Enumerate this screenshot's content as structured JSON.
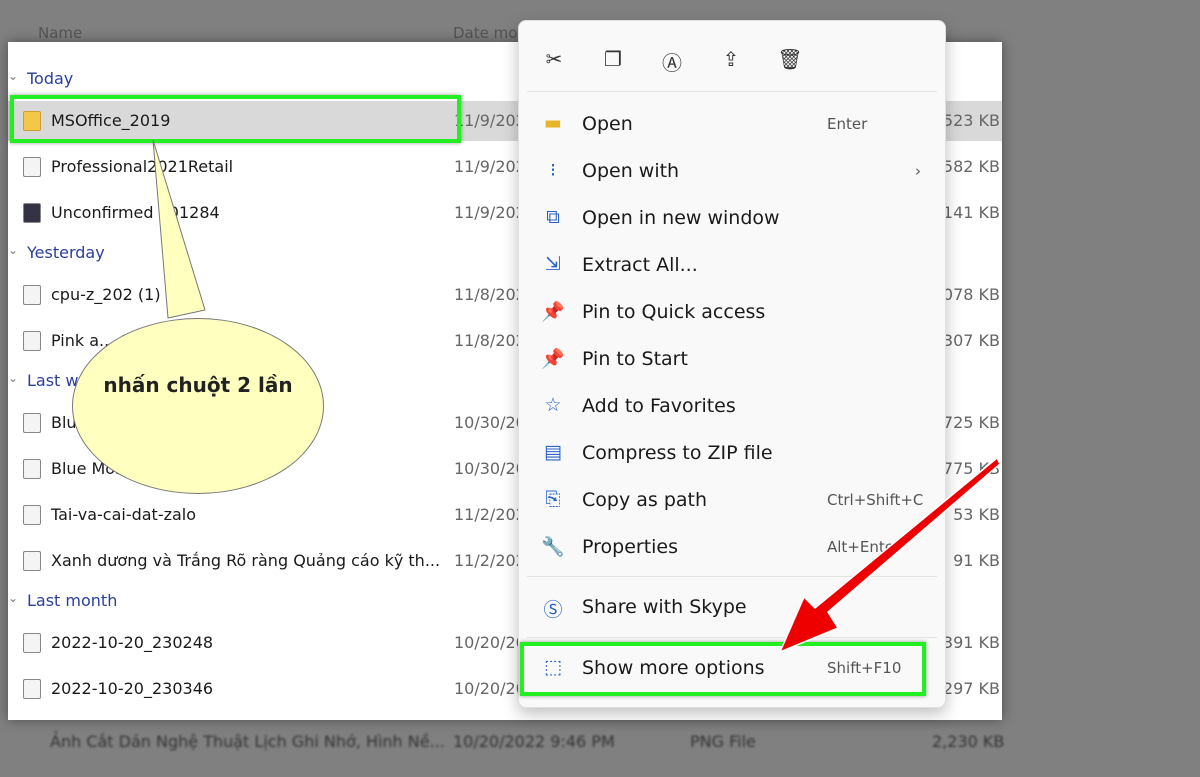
{
  "header": {
    "name_col": "Name",
    "date_col": "Date mo"
  },
  "groups": [
    {
      "label": "Today",
      "files": [
        {
          "name": "MSOffice_2019",
          "date": "11/9/202",
          "size": "523 KB",
          "icon": "zip-folder-icon",
          "selected": true
        },
        {
          "name": "Professional2021Retail",
          "date": "11/9/202",
          "size": "582 KB",
          "icon": "disc-image-icon"
        },
        {
          "name": "Unconfirmed 701284",
          "date": "11/9/202",
          "size": "141 KB",
          "icon": "image-app-icon"
        }
      ]
    },
    {
      "label": "Yesterday",
      "files": [
        {
          "name": "cpu-z_202 (1)",
          "date": "11/8/202",
          "size": "078 KB",
          "icon": "installer-icon"
        },
        {
          "name": "Pink a... Channel Yout...",
          "date": "11/8/202",
          "size": "307 KB",
          "icon": "image-file-icon"
        }
      ]
    },
    {
      "label": "Last w",
      "files": [
        {
          "name": "Blue ... Channel Art",
          "date": "10/30/20",
          "size": "725 KB",
          "icon": "image-file-icon"
        },
        {
          "name": "Blue Mo... Channel Art",
          "date": "10/30/20",
          "size": "775 KB",
          "icon": "image-file-icon"
        },
        {
          "name": "Tai-va-cai-dat-zalo",
          "date": "11/2/202",
          "size": "53 KB",
          "icon": "image-file-icon"
        },
        {
          "name": "Xanh dương và Trắng Rõ ràng Quảng cáo kỹ th...",
          "date": "11/2/202",
          "size": "91 KB",
          "icon": "image-file-icon"
        }
      ]
    },
    {
      "label": "Last month",
      "files": [
        {
          "name": "2022-10-20_230248",
          "date": "10/20/20",
          "size": "391 KB",
          "icon": "image-file-icon"
        },
        {
          "name": "2022-10-20_230346",
          "date": "10/20/20",
          "size": "297 KB",
          "icon": "image-file-icon"
        }
      ]
    }
  ],
  "background_row": {
    "name": "Ảnh Cắt Dán Nghệ Thuật Lịch Ghi Nhớ, Hình Nề...",
    "date": "10/20/2022 9:46 PM",
    "type": "PNG File",
    "size": "2,230 KB"
  },
  "menu": {
    "toolbar": [
      "cut-icon",
      "copy-icon",
      "rename-icon",
      "share-icon",
      "delete-icon"
    ],
    "items": [
      {
        "label": "Open",
        "shortcut": "Enter",
        "icon": "folder-icon"
      },
      {
        "label": "Open with",
        "shortcut": "",
        "icon": "open-with-icon",
        "submenu": true
      },
      {
        "label": "Open in new window",
        "shortcut": "",
        "icon": "new-window-icon"
      },
      {
        "label": "Extract All...",
        "shortcut": "",
        "icon": "extract-icon"
      },
      {
        "label": "Pin to Quick access",
        "shortcut": "",
        "icon": "pin-icon"
      },
      {
        "label": "Pin to Start",
        "shortcut": "",
        "icon": "pin-icon"
      },
      {
        "label": "Add to Favorites",
        "shortcut": "",
        "icon": "star-icon"
      },
      {
        "label": "Compress to ZIP file",
        "shortcut": "",
        "icon": "zip-icon"
      },
      {
        "label": "Copy as path",
        "shortcut": "Ctrl+Shift+C",
        "icon": "copy-path-icon"
      },
      {
        "label": "Properties",
        "shortcut": "Alt+Ente",
        "icon": "wrench-icon"
      }
    ],
    "skype": {
      "label": "Share with Skype",
      "icon": "skype-icon"
    },
    "more": {
      "label": "Show more options",
      "shortcut": "Shift+F10",
      "icon": "show-more-icon"
    }
  },
  "callout": {
    "text": "nhấn chuột 2 lần"
  },
  "colors": {
    "highlight": "#22ee22",
    "arrow": "#ee0000",
    "callout": "#ffffc0",
    "group_header": "#2a3f9a"
  }
}
